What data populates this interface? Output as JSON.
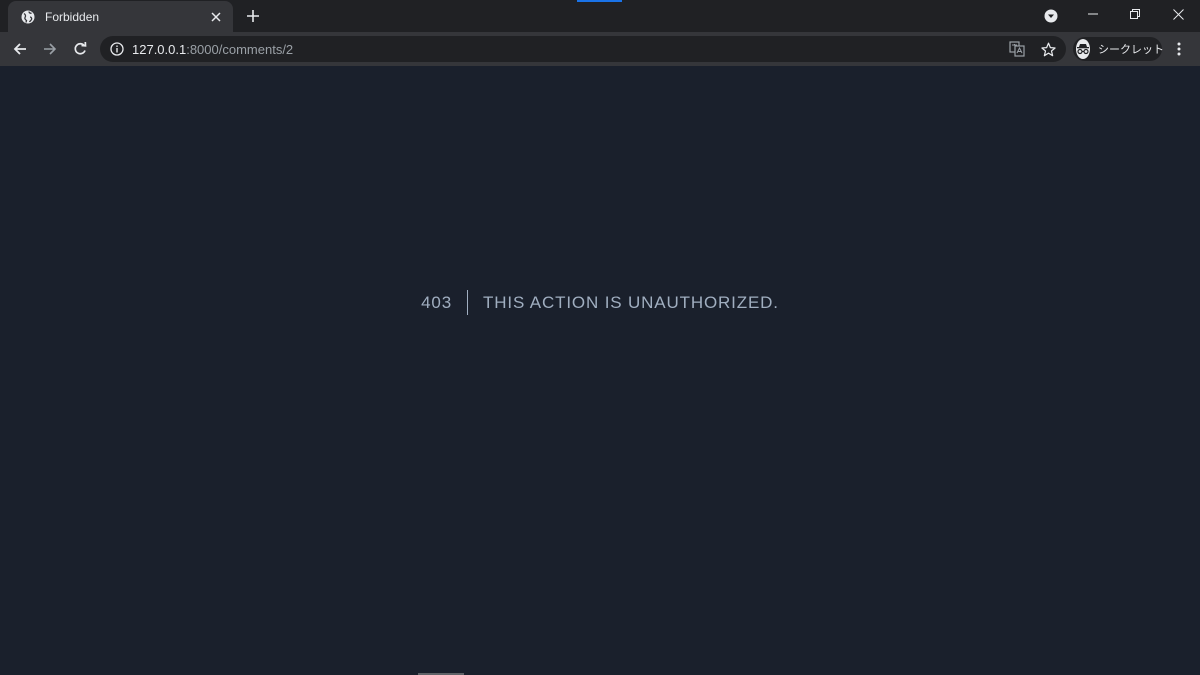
{
  "browser": {
    "tab": {
      "title": "Forbidden"
    },
    "address": {
      "host": "127.0.0.1",
      "path": ":8000/comments/2"
    },
    "profile": {
      "label": "シークレット"
    }
  },
  "page": {
    "error_code": "403",
    "error_message": "This action is unauthorized."
  },
  "colors": {
    "page_background": "#1a202c",
    "error_text": "#a0aec0",
    "accent": "#1a73e8"
  }
}
